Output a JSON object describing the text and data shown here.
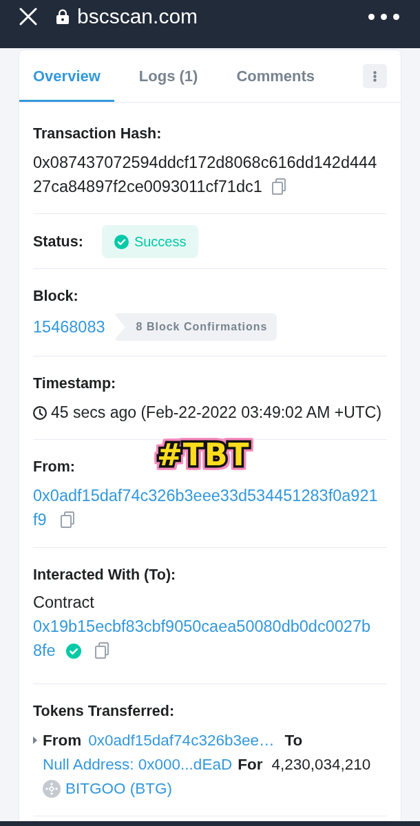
{
  "browser_bar": {
    "url": "bscscan.com"
  },
  "tabs": [
    {
      "label": "Overview",
      "selected": true
    },
    {
      "label": "Logs (1)",
      "selected": false
    },
    {
      "label": "Comments",
      "selected": false
    }
  ],
  "sections": [
    {
      "kind": "hash",
      "label": "Transaction Hash:",
      "value": "0x087437072594ddcf172d8068c616dd142d44427ca84897f2ce0093011cf71dc1"
    },
    {
      "kind": "status",
      "label": "Status:",
      "value": "Success"
    },
    {
      "kind": "block",
      "label": "Block:",
      "value": "15468083",
      "badge": "8 Block Confirmations"
    },
    {
      "kind": "timestamp",
      "label": "Timestamp:",
      "value": "45 secs ago (Feb-22-2022 03:49:02 AM +UTC)"
    },
    {
      "kind": "address",
      "label": "From:",
      "value": "0x0adf15daf74c326b3eee33d534451283f0a921f9"
    },
    {
      "kind": "contract",
      "label": "Interacted With (To):",
      "prefix": "Contract",
      "value": "0x19b15ecbf83cbf9050caea50080db0dc0027b8fe",
      "verified": true
    },
    {
      "kind": "tokens",
      "label": "Tokens Transferred:",
      "transfer": {
        "expanded": false,
        "from_label": "From",
        "from_address": "0x0adf15daf74c326b3ee…",
        "to_label": "To",
        "to_address": "Null Address: 0x000...dEaD",
        "for_label": "For",
        "amount": "4,230,034,210",
        "token": "BITGOO (BTG)"
      }
    }
  ],
  "sticker": {
    "text": "#TBT"
  }
}
